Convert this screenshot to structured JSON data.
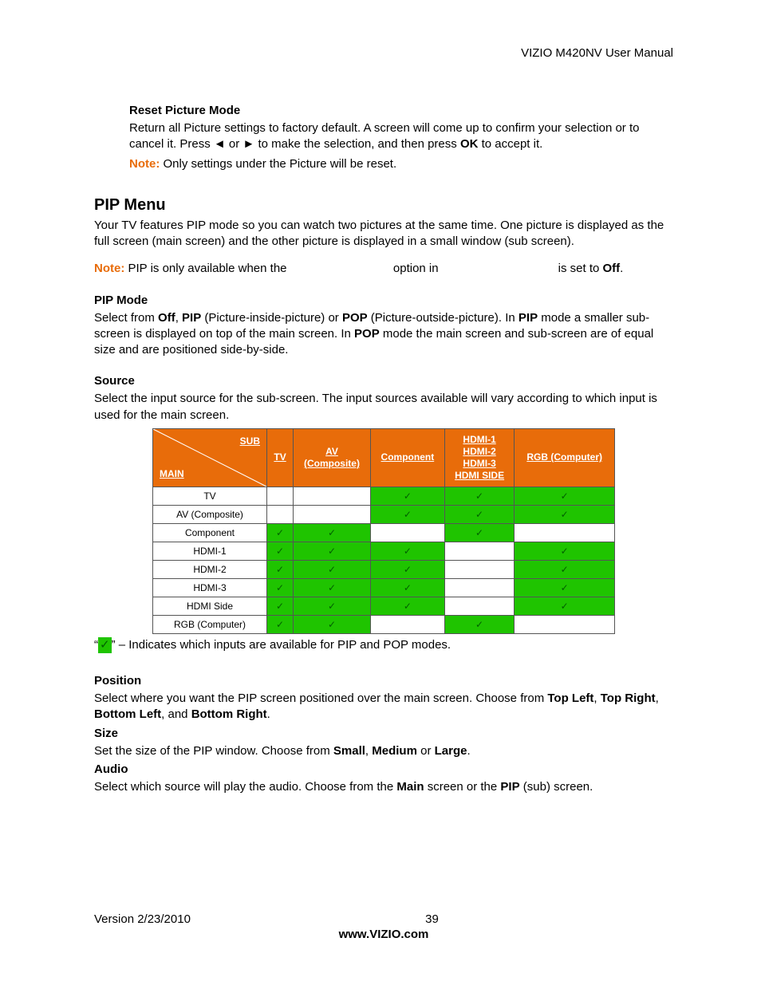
{
  "header": {
    "doc_title": "VIZIO M420NV User Manual"
  },
  "reset": {
    "heading": "Reset Picture Mode",
    "body_pre": "Return all Picture settings to factory default. A screen will come up to confirm your selection or to cancel it. Press ",
    "arrow_left": "◄",
    "body_or": " or ",
    "arrow_right": "►",
    "body_mid": " to make the selection, and then press ",
    "ok_label": "OK",
    "body_post": " to accept it.",
    "note_label": "Note:",
    "note_text": " Only settings under the Picture will be reset."
  },
  "pip_menu": {
    "heading": "PIP Menu",
    "intro": "Your TV features PIP mode so you can watch two pictures at the same time. One picture is displayed as the full screen (main screen) and the other picture is displayed in a small window (sub screen).",
    "note_label": "Note:",
    "note_text_pre": " PIP is only available when the ",
    "note_text_mid": " option in ",
    "note_text_post": " is set to ",
    "off_label": "Off",
    "note_period": "."
  },
  "pip_mode": {
    "heading": "PIP Mode",
    "t1": "Select from ",
    "off": "Off",
    "t2": ", ",
    "pip": "PIP",
    "t3": " (Picture-inside-picture) or ",
    "pop": "POP",
    "t4": " (Picture-outside-picture). In ",
    "pip2": "PIP",
    "t5": " mode a smaller sub-screen is displayed on top of the main screen. In ",
    "pop2": "POP",
    "t6": " mode the main screen and sub-screen are of equal size and are positioned side-by-side."
  },
  "source": {
    "heading": "Source",
    "intro": "Select the input source for the sub-screen. The input sources available will vary according to which input is used for the main screen.",
    "corner_sub": "SUB",
    "corner_main": "MAIN",
    "cols": [
      "TV",
      "AV\n(Composite)",
      "Component",
      "HDMI-1\nHDMI-2\nHDMI-3\nHDMI SIDE",
      "RGB (Computer)"
    ],
    "rows": [
      {
        "label": "TV",
        "cells": [
          false,
          false,
          true,
          true,
          true
        ]
      },
      {
        "label": "AV (Composite)",
        "cells": [
          false,
          false,
          true,
          true,
          true
        ]
      },
      {
        "label": "Component",
        "cells": [
          true,
          true,
          false,
          true,
          false
        ]
      },
      {
        "label": "HDMI-1",
        "cells": [
          true,
          true,
          true,
          false,
          true
        ]
      },
      {
        "label": "HDMI-2",
        "cells": [
          true,
          true,
          true,
          false,
          true
        ]
      },
      {
        "label": "HDMI-3",
        "cells": [
          true,
          true,
          true,
          false,
          true
        ]
      },
      {
        "label": "HDMI Side",
        "cells": [
          true,
          true,
          true,
          false,
          true
        ]
      },
      {
        "label": "RGB (Computer)",
        "cells": [
          true,
          true,
          false,
          true,
          false
        ]
      }
    ],
    "legend_pre": "“",
    "legend_mark": "✓",
    "legend_post": "” – Indicates which inputs are available for PIP and POP modes."
  },
  "position": {
    "heading": "Position",
    "t1": "Select where you want the PIP screen positioned over the main screen. Choose from ",
    "tl": "Top Left",
    "c1": ", ",
    "tr": "Top Right",
    "c2": ", ",
    "bl": "Bottom Left",
    "c3": ", and ",
    "br": "Bottom Right",
    "c4": "."
  },
  "size": {
    "heading": "Size",
    "t1": "Set the size of the PIP window. Choose from ",
    "small": "Small",
    "c1": ", ",
    "medium": "Medium",
    "c2": " or ",
    "large": "Large",
    "c3": "."
  },
  "audio": {
    "heading": "Audio",
    "t1": "Select which source will play the audio. Choose from the ",
    "main": "Main",
    "t2": " screen or the ",
    "pip": "PIP",
    "t3": " (sub) screen."
  },
  "footer": {
    "version": "Version 2/23/2010",
    "page": "39",
    "site": "www.VIZIO.com"
  },
  "marks": {
    "check": "✓"
  }
}
